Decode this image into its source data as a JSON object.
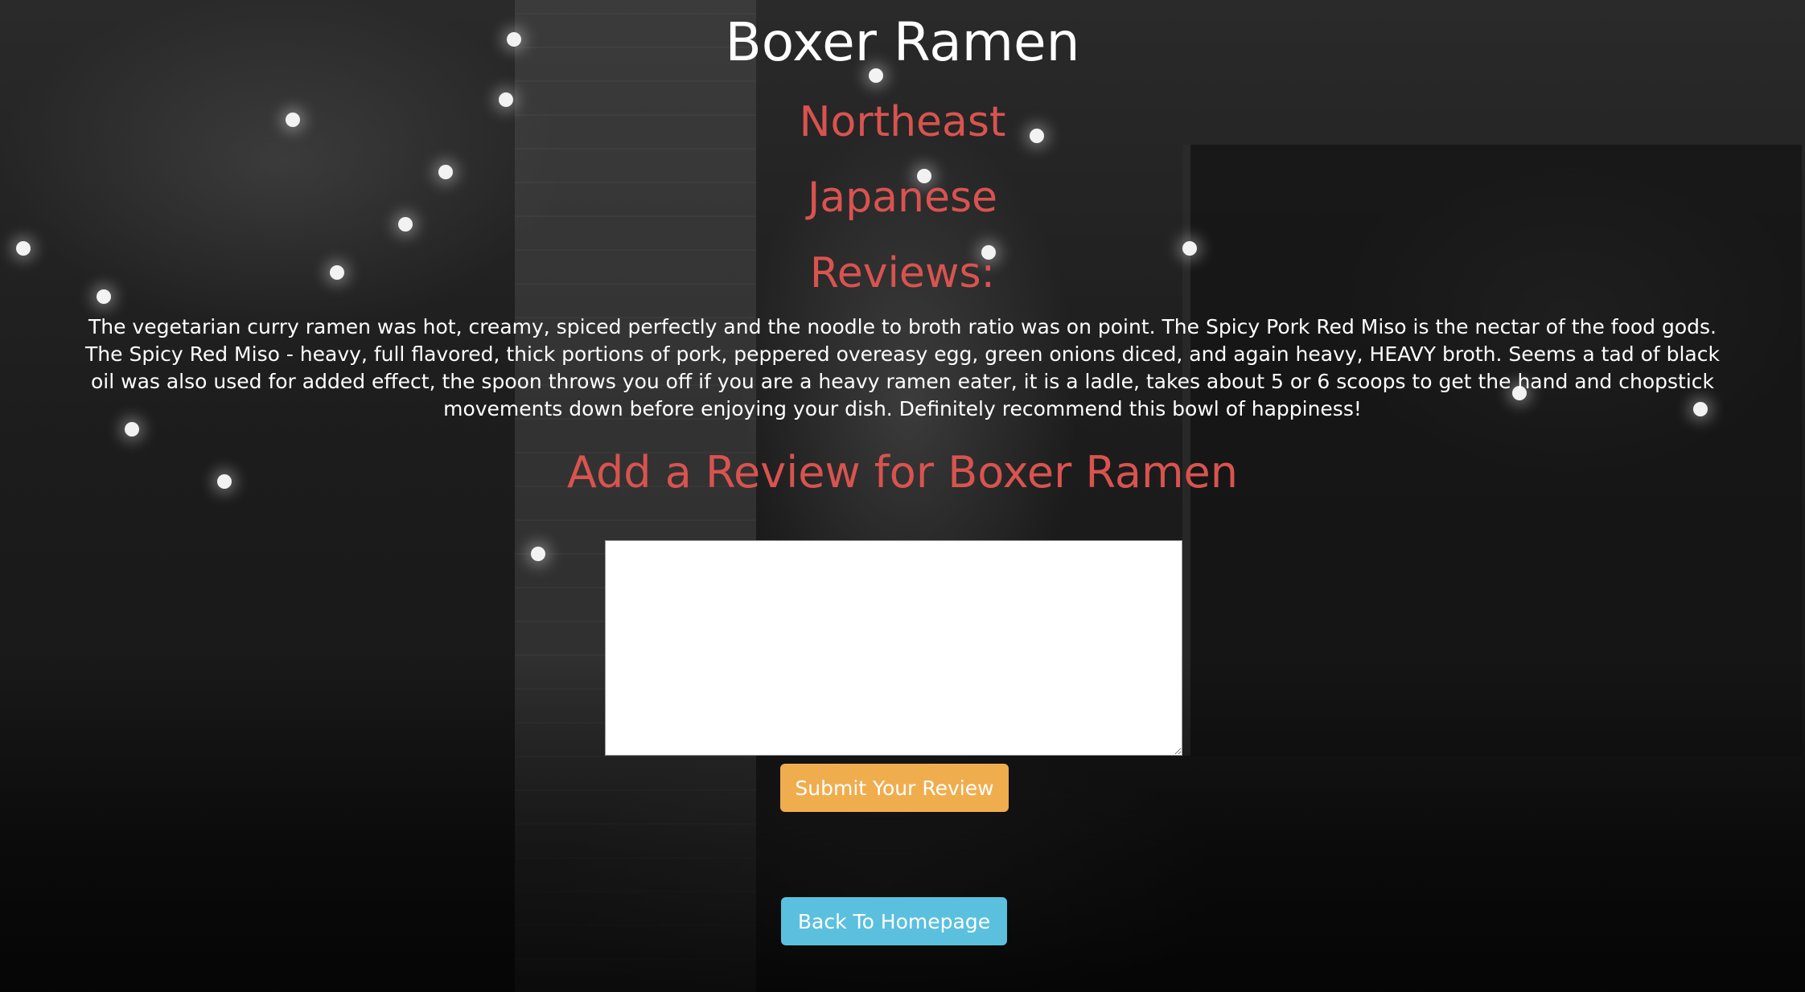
{
  "restaurant": {
    "name": "Boxer Ramen",
    "region": "Northeast",
    "cuisine": "Japanese"
  },
  "reviews": {
    "heading": "Reviews:",
    "text": "The vegetarian curry ramen was hot, creamy, spiced perfectly and the noodle to broth ratio was on point. The Spicy Pork Red Miso is the nectar of the food gods. The Spicy Red Miso - heavy, full flavored, thick portions of pork, peppered overeasy egg, green onions diced, and again heavy, HEAVY broth. Seems a tad of black oil was also used for added effect, the spoon throws you off if you are a heavy ramen eater, it is a ladle, takes about 5 or 6 scoops to get the hand and chopstick movements down before enjoying your dish. Definitely recommend this bowl of happiness!"
  },
  "add_review": {
    "heading": "Add a Review for Boxer Ramen",
    "input_value": "",
    "submit_label": "Submit Your Review"
  },
  "navigation": {
    "home_label": "Back To Homepage"
  },
  "colors": {
    "accent_red": "#d9534f",
    "submit_orange": "#f0ad4e",
    "home_blue": "#5bc0de",
    "title_white": "#ffffff"
  }
}
